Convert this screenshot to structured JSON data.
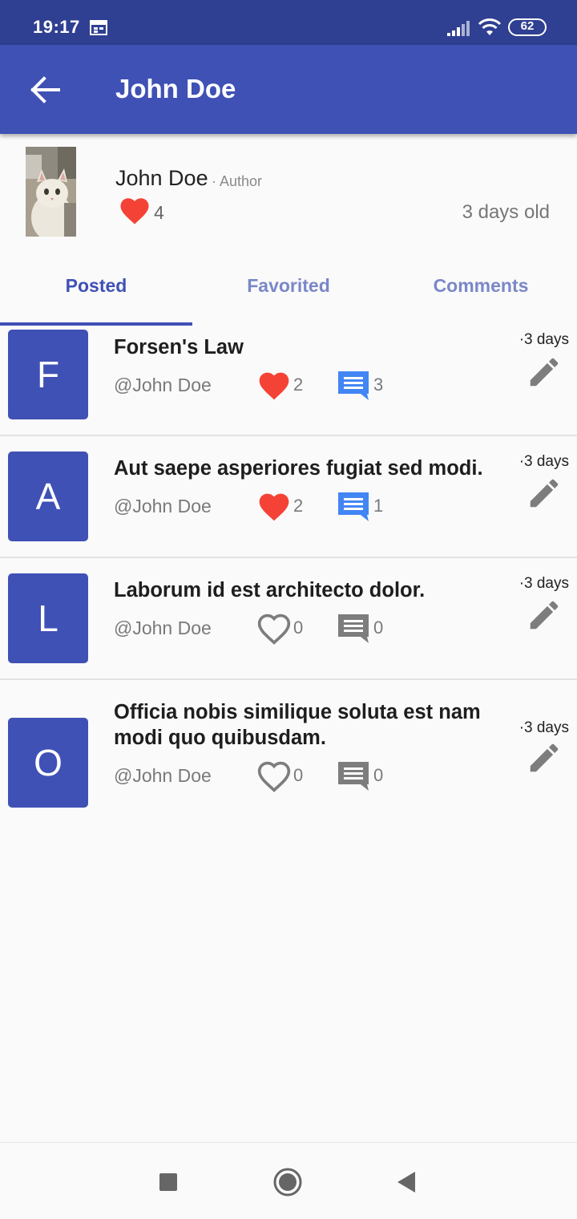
{
  "status_bar": {
    "time": "19:17",
    "battery": "62",
    "icons": [
      "calendar-icon",
      "signal-icon",
      "wifi-icon",
      "battery-icon"
    ]
  },
  "app_bar": {
    "title": "John Doe",
    "back_icon": "arrow-back-icon",
    "color": "#3f51b5"
  },
  "profile": {
    "name": "John Doe",
    "role": "· Author",
    "likes": "4",
    "age": "3 days old",
    "heart_color": "#f44336"
  },
  "tabs": [
    {
      "label": "Posted",
      "active": true
    },
    {
      "label": "Favorited",
      "active": false
    },
    {
      "label": "Comments",
      "active": false
    }
  ],
  "posts": [
    {
      "letter": "F",
      "title": "Forsen's Law",
      "author": "@John Doe",
      "likes": "2",
      "liked": true,
      "comments": "3",
      "has_comments": true,
      "age": "·3 days"
    },
    {
      "letter": "A",
      "title": "Aut saepe asperiores fugiat sed modi.",
      "author": "@John Doe",
      "likes": "2",
      "liked": true,
      "comments": "1",
      "has_comments": true,
      "age": "·3 days"
    },
    {
      "letter": "L",
      "title": "Laborum id est architecto dolor.",
      "author": "@John Doe",
      "likes": "0",
      "liked": false,
      "comments": "0",
      "has_comments": false,
      "age": "·3 days"
    },
    {
      "letter": "O",
      "title": "Officia nobis similique soluta est nam modi quo quibusdam.",
      "author": "@John Doe",
      "likes": "0",
      "liked": false,
      "comments": "0",
      "has_comments": false,
      "age": "·3 days"
    }
  ],
  "nav_bar": {
    "buttons": [
      "recents-square-icon",
      "home-circle-icon",
      "back-triangle-icon"
    ]
  },
  "colors": {
    "primary": "#3f51b5",
    "status_bar": "#2f3f91",
    "liked_heart": "#f44336",
    "comment_active": "#4285f4",
    "icon_inactive": "#7d7d7d"
  }
}
